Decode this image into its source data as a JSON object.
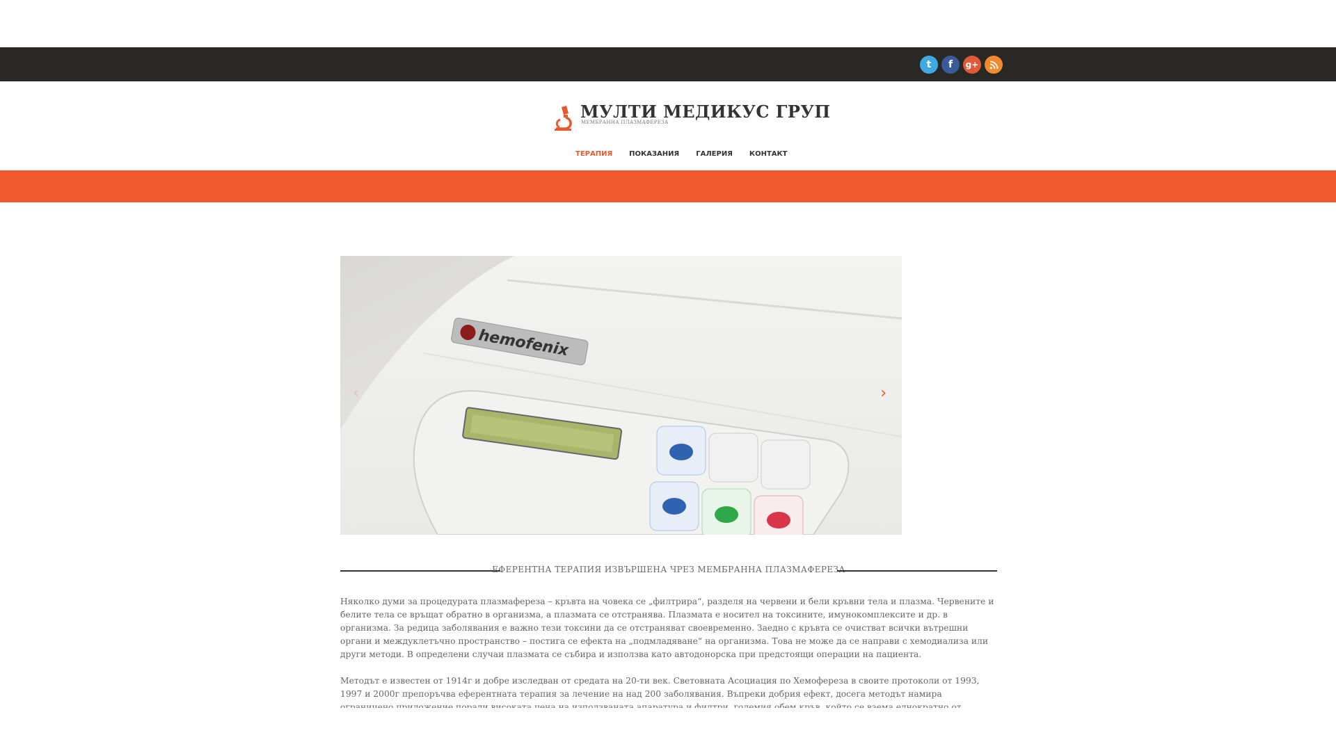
{
  "header": {
    "social": [
      {
        "name": "twitter",
        "glyph": "t"
      },
      {
        "name": "facebook",
        "glyph": "f"
      },
      {
        "name": "google-plus",
        "glyph": "g+"
      },
      {
        "name": "rss",
        "glyph": "☰"
      }
    ]
  },
  "logo": {
    "title": "МУЛТИ МЕДИКУС ГРУП",
    "subtitle": "МЕМБРАННА ПЛАЗМАФЕРЕЗА"
  },
  "nav": [
    {
      "label": "ТЕРАПИЯ",
      "active": true
    },
    {
      "label": "ПОКАЗАНИЯ",
      "active": false
    },
    {
      "label": "ГАЛЕРИЯ",
      "active": false
    },
    {
      "label": "КОНТАКТ",
      "active": false
    }
  ],
  "slider": {
    "brand": "hemofenix",
    "prev": "‹",
    "next": "›"
  },
  "section": {
    "title": "ЕФЕРЕНТНА ТЕРАПИЯ ИЗВЪРШЕНА ЧРЕЗ МЕМБРАННА ПЛАЗМАФЕРЕЗА"
  },
  "content": {
    "p1": "Няколко думи за процедурата плазмафереза – кръвта на човека се „филтрира“, разделя на червени и бели кръвни тела и плазма. Червените и белите тела се връщат обратно в организма, а плазмата се отстранява. Плазмата е носител на токсините, имунокомплексите и др. в организма. За редица заболявания е важно тези токсини да се отстраняват своевременно. Заедно с кръвта се очистват всички вътрешни органи и междуклетъчно пространство – постига се ефекта на „подмладяване“ на организма. Това не може да се направи с хемодиализа или други методи. В определени случаи плазмата се събира и използва като автодонорска при предстоящи операции на пациента.",
    "p2": "Методът е известен от 1914г и добре изследван от средата на 20-ти век. Световната Асоциация по Хемофереза в своите протоколи от 1993, 1997 и 2000г препоръчва еферентната терапия за лечение на над 200 заболявания. Въпреки добрия ефект, досега методът намира ограничено приложение поради високата цена на използваната апаратура и филтри, големия обем кръв, който се взема еднократно от пациента и"
  }
}
